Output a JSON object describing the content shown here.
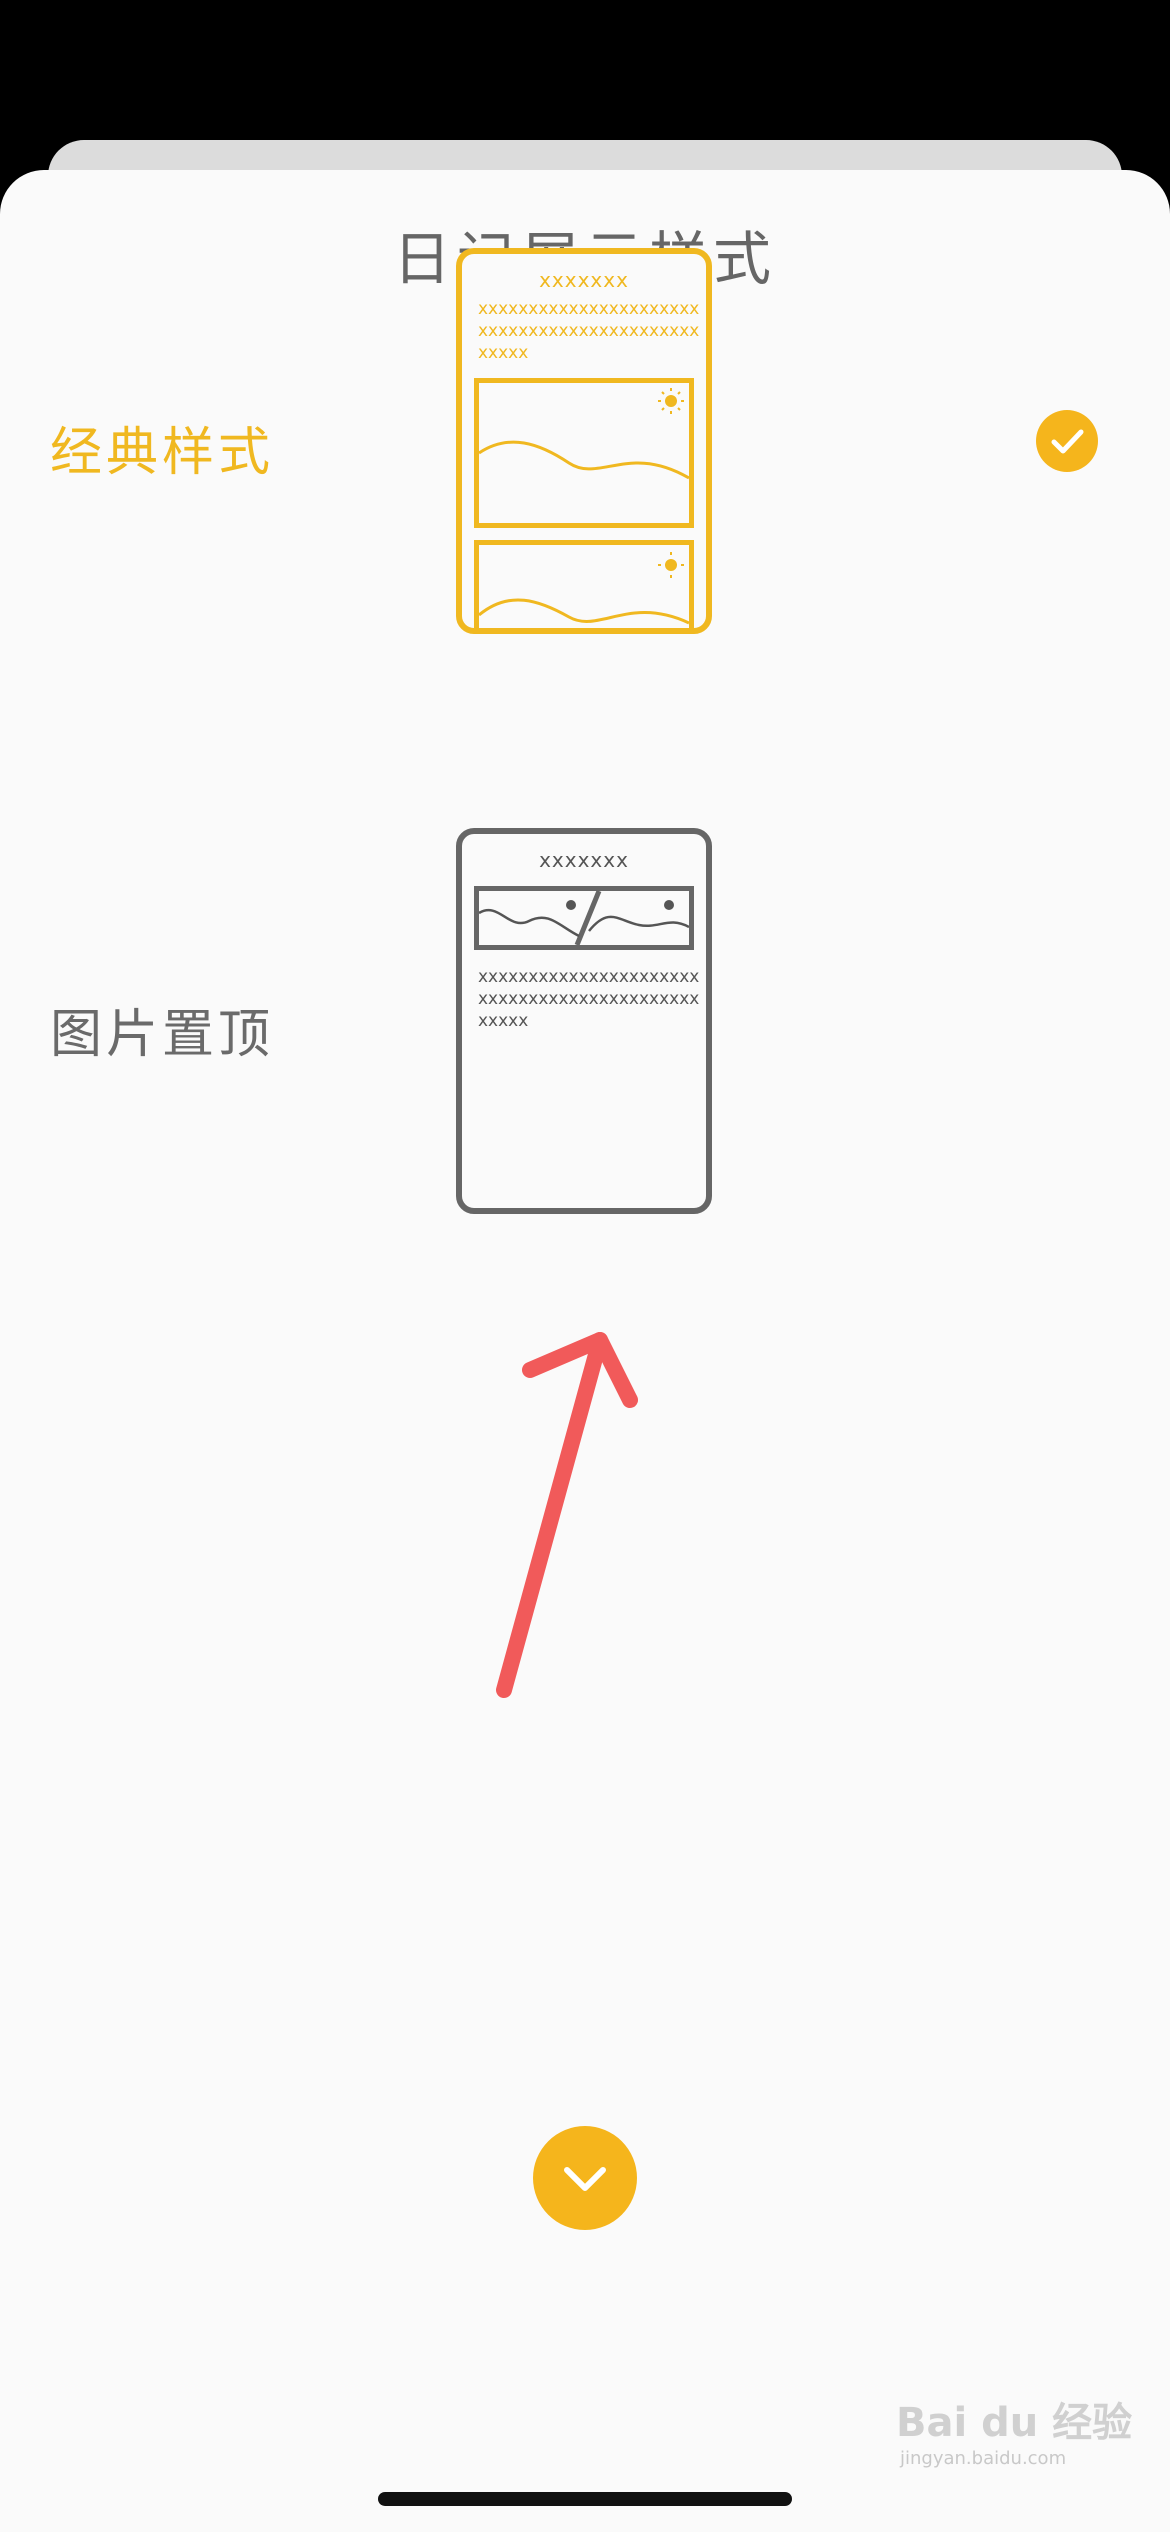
{
  "sheet": {
    "title": "日记展示样式"
  },
  "options": [
    {
      "label": "经典样式",
      "selected": true,
      "preview_title": "xxxxxxx",
      "preview_text": "xxxxxxxxxxxxxxxxxxxxxxxxxxxxxxxxxxxxxxxxxxxxxxxxx"
    },
    {
      "label": "图片置顶",
      "selected": false,
      "preview_title": "xxxxxxx",
      "preview_text": "xxxxxxxxxxxxxxxxxxxxxxxxxxxxxxxxxxxxxxxxxxxxxxxxx"
    }
  ],
  "watermark": {
    "main": "Bai du 经验",
    "sub": "jingyan.baidu.com"
  },
  "colors": {
    "accent": "#f5b51c",
    "selected_text": "#f0b820",
    "unselected": "#666666",
    "annotation_arrow": "#f15a5a"
  },
  "icons": {
    "selected_marker": "check-icon",
    "confirm_button": "chevron-down-icon",
    "preview_weather": "sun-icon"
  }
}
